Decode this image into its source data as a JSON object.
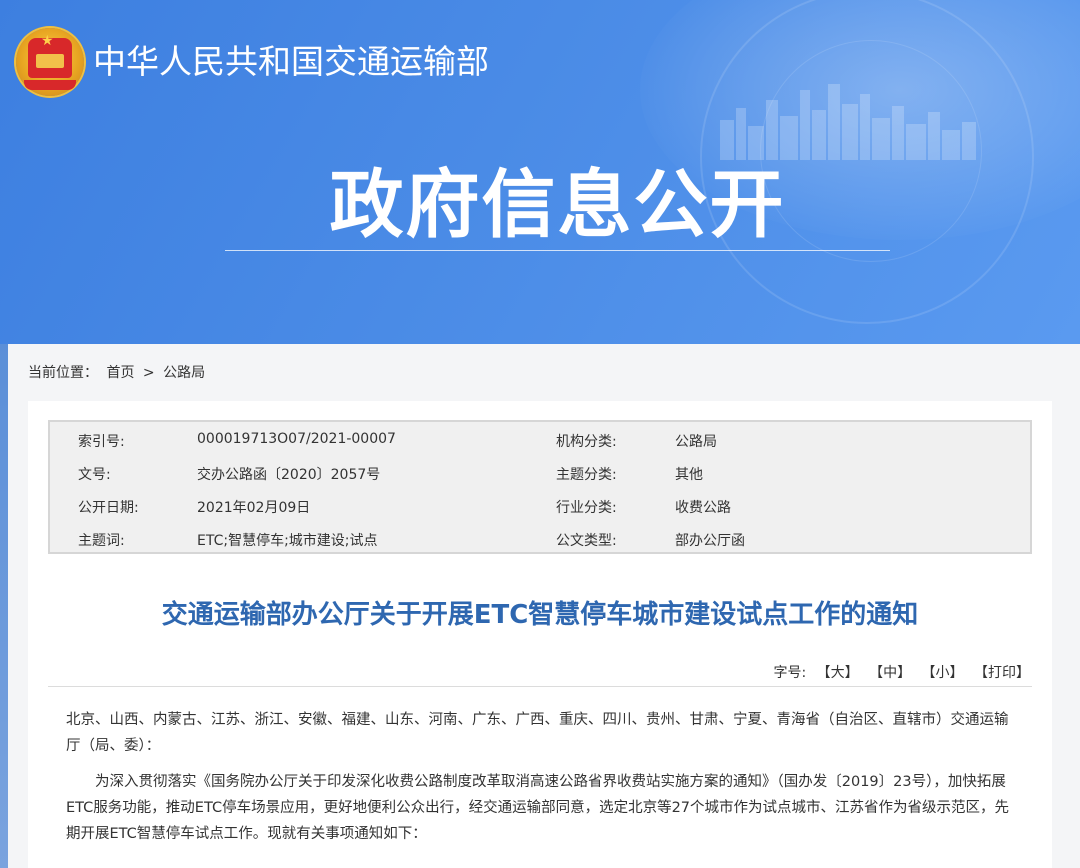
{
  "header": {
    "site_title": "中华人民共和国交通运输部",
    "section_title": "政府信息公开"
  },
  "breadcrumb": {
    "label": "当前位置：",
    "home": "首页",
    "separator": ">",
    "current": "公路局"
  },
  "meta": {
    "rows": [
      {
        "k1": "索引号:",
        "v1": "000019713O07/2021-00007",
        "k2": "机构分类:",
        "v2": "公路局"
      },
      {
        "k1": "文号:",
        "v1": "交办公路函〔2020〕2057号",
        "k2": "主题分类:",
        "v2": "其他"
      },
      {
        "k1": "公开日期:",
        "v1": "2021年02月09日",
        "k2": "行业分类:",
        "v2": "收费公路"
      },
      {
        "k1": "主题词:",
        "v1": "ETC;智慧停车;城市建设;试点",
        "k2": "公文类型:",
        "v2": "部办公厅函"
      }
    ]
  },
  "article": {
    "title": "交通运输部办公厅关于开展ETC智慧停车城市建设试点工作的通知",
    "font_label": "字号:",
    "font_large": "【大】",
    "font_medium": "【中】",
    "font_small": "【小】",
    "print": "【打印】",
    "para1": "北京、山西、内蒙古、江苏、浙江、安徽、福建、山东、河南、广东、广西、重庆、四川、贵州、甘肃、宁夏、青海省（自治区、直辖市）交通运输厅（局、委）：",
    "para2": "为深入贯彻落实《国务院办公厅关于印发深化收费公路制度改革取消高速公路省界收费站实施方案的通知》（国办发〔2019〕23号），加快拓展ETC服务功能，推动ETC停车场景应用，更好地便利公众出行，经交通运输部同意，选定北京等27个城市作为试点城市、江苏省作为省级示范区，先期开展ETC智慧停车试点工作。现就有关事项通知如下："
  },
  "colors": {
    "banner": "#4a8be6",
    "title_blue": "#2e67b0"
  }
}
